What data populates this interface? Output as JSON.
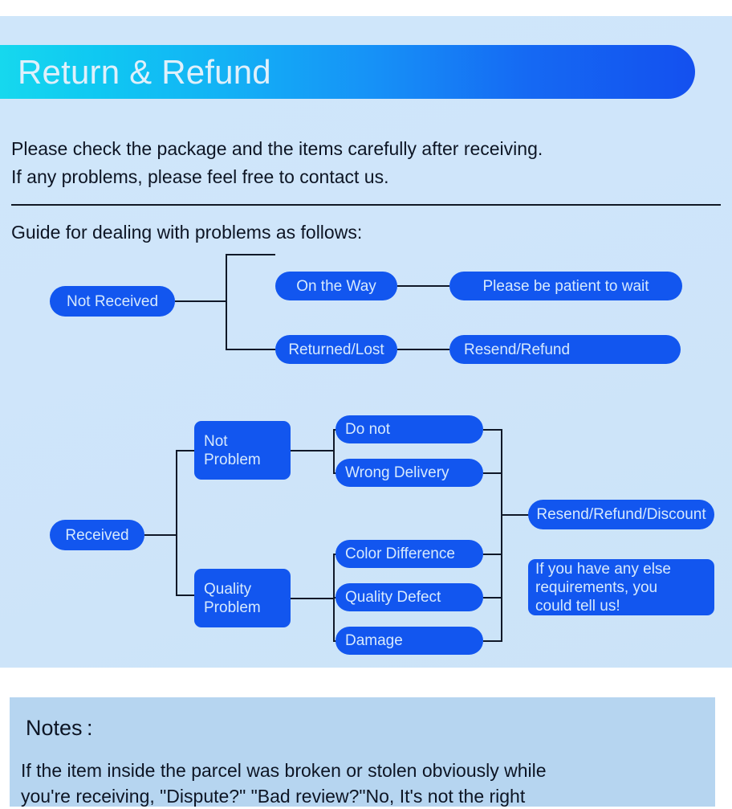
{
  "header": {
    "title": "Return & Refund"
  },
  "intro": {
    "line1": "Please check the package and the items carefully after receiving.",
    "line2": "If any problems, please feel free to contact us.",
    "guide": "Guide for dealing with problems as follows:"
  },
  "flow_not_received": {
    "root": "Not Received",
    "branches": [
      {
        "condition": "On the Way",
        "result": "Please be patient to wait"
      },
      {
        "condition": "Returned/Lost",
        "result": "Resend/Refund"
      }
    ]
  },
  "flow_received": {
    "root": "Received",
    "categories": [
      {
        "label_line1": "Not",
        "label_line2": "Problem",
        "items": [
          "Do not",
          "Wrong Delivery"
        ]
      },
      {
        "label_line1": "Quality",
        "label_line2": "Problem",
        "items": [
          "Color Difference",
          "Quality Defect",
          "Damage"
        ]
      }
    ],
    "outcomes": [
      {
        "text": "Resend/Refund/Discount"
      },
      {
        "line1": "If you have any else",
        "line2": "requirements, you",
        "line3": "could tell us!"
      }
    ]
  },
  "notes": {
    "title": "Notes :",
    "line1": "If the item inside the parcel was broken or stolen obviously while",
    "line2": "you're receiving, \"Dispute?\" \"Bad review?\"No, It's not the right"
  },
  "colors": {
    "panel_bg": "#cfe6fa",
    "notes_bg": "#b6d5f0",
    "node_blue": "#1256ef",
    "node_text": "#d6e9fd",
    "header_gradient_start": "#16d8ee",
    "header_gradient_end": "#1450ef",
    "connector": "#101828",
    "body_text": "#0d1524"
  }
}
